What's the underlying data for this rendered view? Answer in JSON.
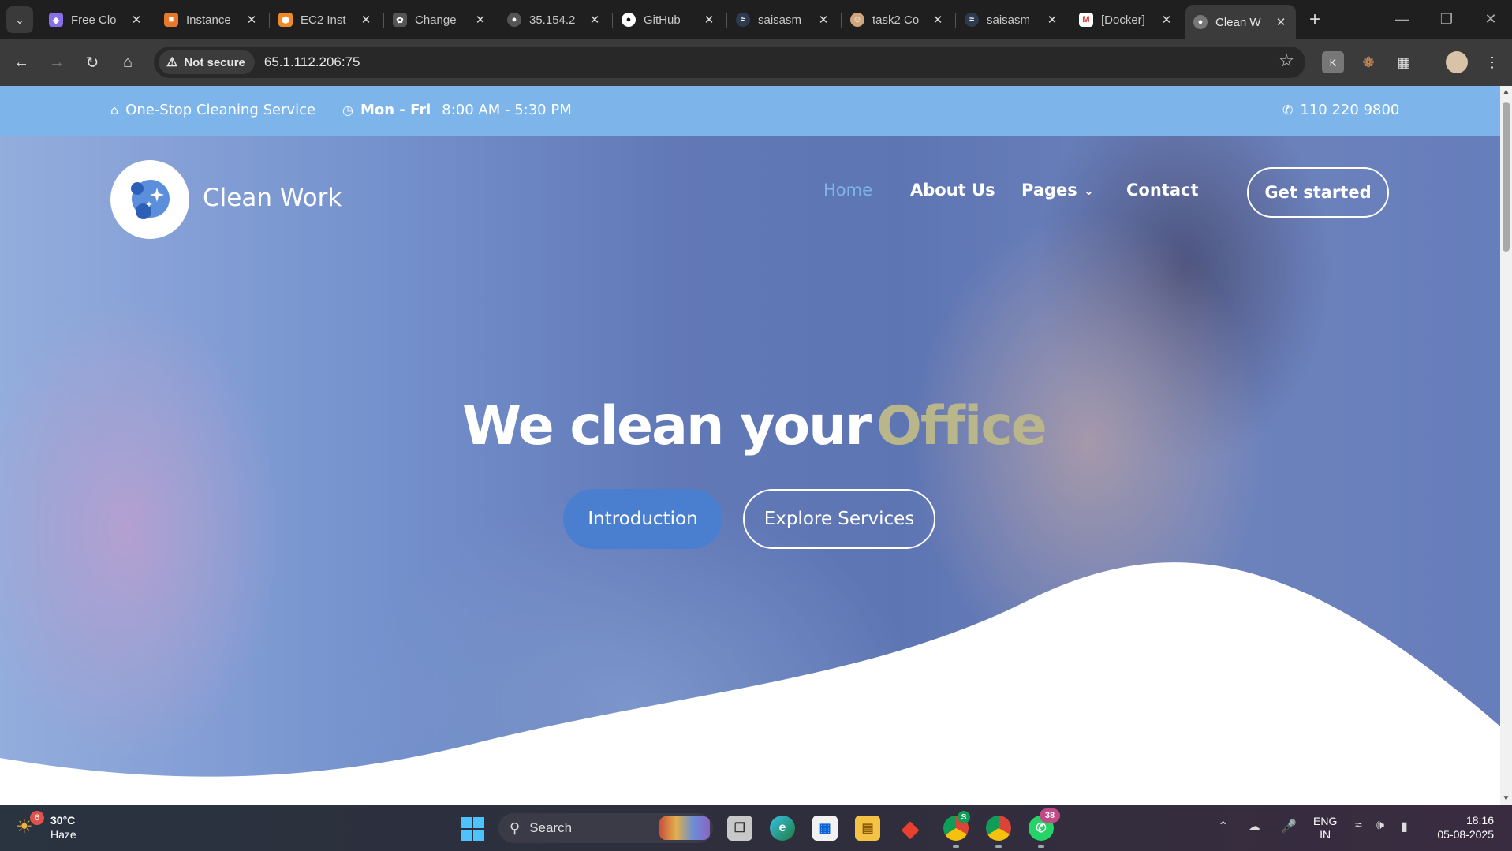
{
  "browser": {
    "tabs": [
      {
        "title": "Free Clo",
        "icon": "cube-icon",
        "color": "#8a6de9"
      },
      {
        "title": "Instance",
        "icon": "aws-icon",
        "color": "#e8782a"
      },
      {
        "title": "EC2 Inst",
        "icon": "aws-ec2-icon",
        "color": "#f08a24"
      },
      {
        "title": "Change",
        "icon": "openai-icon",
        "color": "#555555"
      },
      {
        "title": "35.154.2",
        "icon": "globe-icon",
        "color": "#555555"
      },
      {
        "title": "GitHub",
        "icon": "github-icon",
        "color": "#222222"
      },
      {
        "title": "saisasm",
        "icon": "docker-icon",
        "color": "#2e3a4f"
      },
      {
        "title": "task2 Co",
        "icon": "avatar-icon",
        "color": "#d1a67a"
      },
      {
        "title": "saisasm",
        "icon": "docker-icon",
        "color": "#2e3a4f"
      },
      {
        "title": "[Docker]",
        "icon": "gmail-icon",
        "color": "#ffffff"
      },
      {
        "title": "Clean W",
        "icon": "globe-icon",
        "color": "#555555",
        "active": true
      }
    ],
    "security_label": "Not secure",
    "url": "65.1.112.206:75"
  },
  "topbar": {
    "tagline": "One-Stop Cleaning Service",
    "days": "Mon - Fri",
    "hours": "8:00 AM - 5:30 PM",
    "phone": "110 220 9800"
  },
  "site": {
    "brand": "Clean Work",
    "nav": {
      "home": "Home",
      "about": "About Us",
      "pages": "Pages",
      "contact": "Contact"
    },
    "cta": "Get started"
  },
  "hero": {
    "headline_main": "We clean your",
    "headline_highlight": "Office",
    "btn_intro": "Introduction",
    "btn_explore": "Explore Services"
  },
  "taskbar": {
    "weather_badge": "6",
    "temperature": "30°C",
    "condition": "Haze",
    "search_label": "Search",
    "whatsapp_badge": "38",
    "chrome_badge": "S",
    "lang_top": "ENG",
    "lang_bottom": "IN",
    "time": "18:16",
    "date": "05-08-2025"
  },
  "colors": {
    "topbar_bg": "#7db5ea",
    "accent_blue": "#4a7fd0",
    "headline_highlight": "#b8b68a"
  }
}
